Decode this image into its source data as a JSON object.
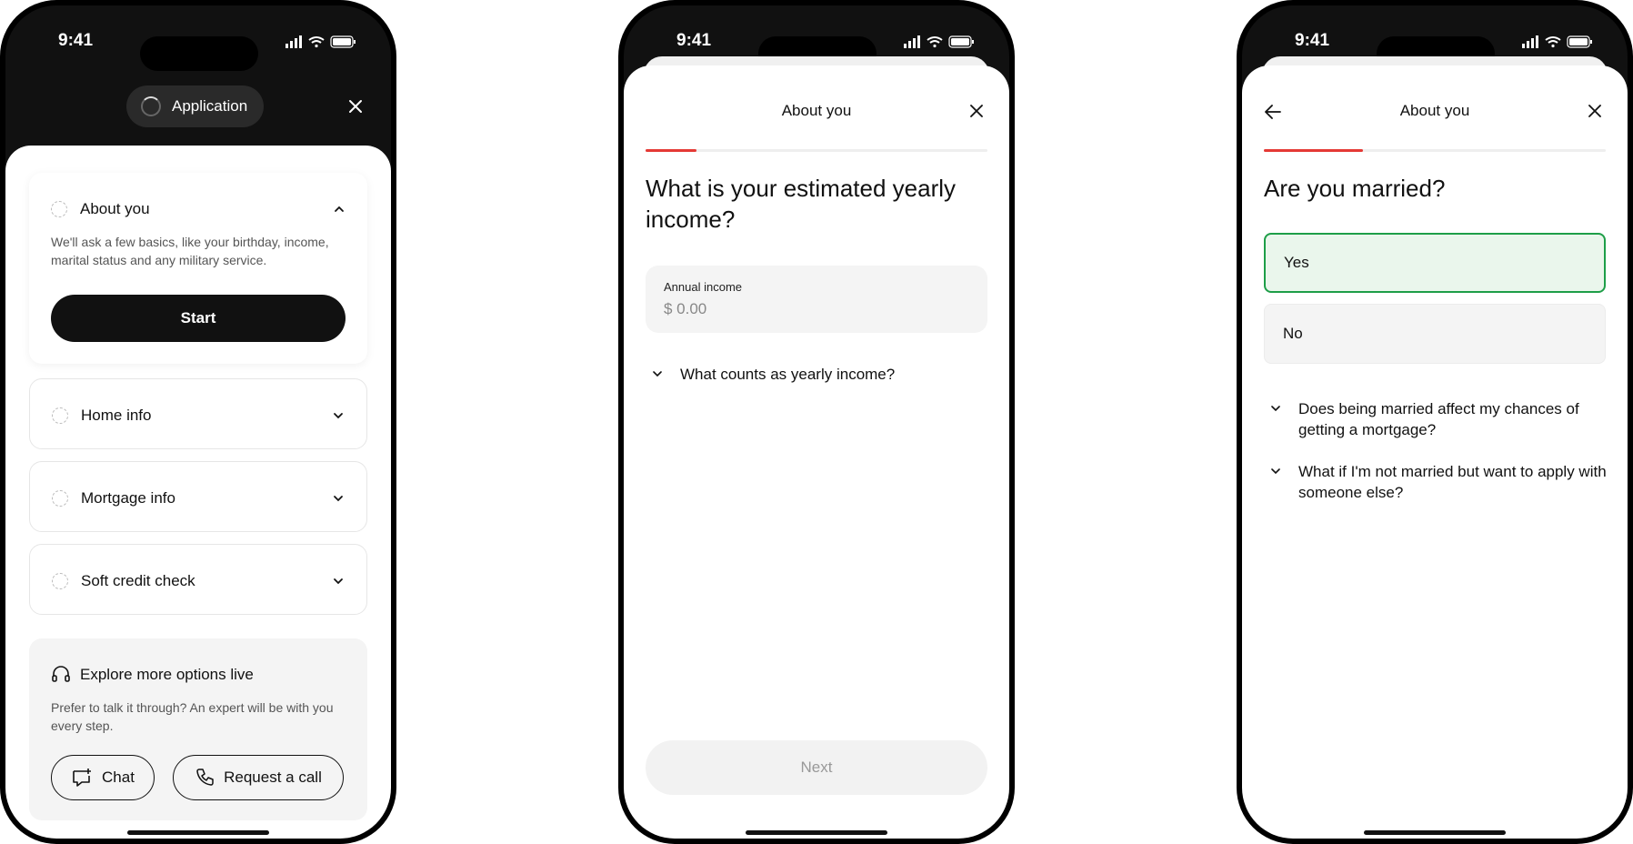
{
  "status_bar": {
    "time": "9:41"
  },
  "screen1": {
    "header_pill": "Application",
    "sections": [
      {
        "title": "About you",
        "description": "We'll ask a few basics, like your birthday, income, marital status and any military service.",
        "button": "Start"
      },
      {
        "title": "Home info"
      },
      {
        "title": "Mortgage info"
      },
      {
        "title": "Soft credit check"
      }
    ],
    "live": {
      "title": "Explore more options live",
      "text": "Prefer to talk it through? An expert will be with you every step.",
      "chat": "Chat",
      "call": "Request a call"
    }
  },
  "screen2": {
    "title": "About you",
    "progress": 0.15,
    "question": "What is your estimated yearly income?",
    "input_label": "Annual income",
    "input_placeholder": "$ 0.00",
    "faq": "What counts as yearly income?",
    "next": "Next"
  },
  "screen3": {
    "title": "About you",
    "progress": 0.29,
    "question": "Are you married?",
    "options": [
      "Yes",
      "No"
    ],
    "selected_option": "Yes",
    "faq1": "Does being married affect my chances of getting a mortgage?",
    "faq2": "What if I'm not married but want to apply with someone else?"
  },
  "colors": {
    "progress": "#e53935",
    "selected_border": "#1e9e48",
    "selected_bg": "#eaf6ec"
  },
  "icons": [
    "signal-icon",
    "wifi-icon",
    "battery-icon",
    "close-icon",
    "chevron-up-icon",
    "chevron-down-icon",
    "headset-icon",
    "chat-icon",
    "phone-icon",
    "back-arrow-icon"
  ]
}
